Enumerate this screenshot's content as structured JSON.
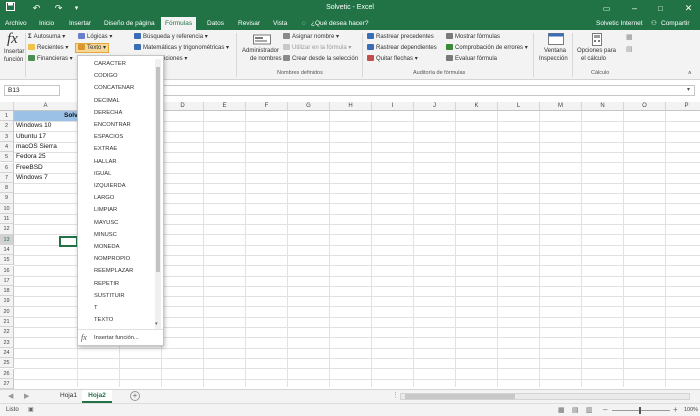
{
  "app": {
    "title": "Solvetic - Excel",
    "user": "Solvetic Internet",
    "share": "Compartir",
    "search_placeholder": "¿Qué desea hacer?"
  },
  "tabs": [
    "Archivo",
    "Inicio",
    "Insertar",
    "Diseño de página",
    "Fórmulas",
    "Datos",
    "Revisar",
    "Vista"
  ],
  "ribbon": {
    "insert_function": [
      "Insertar",
      "función"
    ],
    "autosuma": "Autosuma",
    "recientes": "Recientes",
    "financieras": "Financieras",
    "logicas": "Lógicas",
    "texto": "Texto",
    "busqueda": "Búsqueda y referencia",
    "matematicas": "Matemáticas y trigonométricas",
    "funciones_partial": "iciones",
    "admin_nombres": [
      "Administrador",
      "de nombres"
    ],
    "asignar_nombre": "Asignar nombre",
    "utilizar_formula": "Utilizar en la fórmula",
    "crear_seleccion": "Crear desde la selección",
    "nombres_definidos": "Nombres definidos",
    "rastrear_precedentes": "Rastrear precedentes",
    "rastrear_dependientes": "Rastrear dependientes",
    "quitar_flechas": "Quitar flechas",
    "mostrar_formulas": "Mostrar fórmulas",
    "comprobacion_errores": "Comprobación de errores",
    "evaluar_formula": "Evaluar fórmula",
    "auditoria": "Auditoría de fórmulas",
    "ventana_inspeccion": [
      "Ventana",
      "Inspección"
    ],
    "opciones_calculo": [
      "Opciones para",
      "el cálculo"
    ],
    "calculo": "Cálculo"
  },
  "namebox": "B13",
  "columns": [
    "A",
    "B",
    "C",
    "D",
    "E",
    "F",
    "G",
    "H",
    "I",
    "J",
    "K",
    "L",
    "M",
    "N",
    "O",
    "P"
  ],
  "rows": [
    "1",
    "2",
    "3",
    "4",
    "5",
    "6",
    "7",
    "8",
    "9",
    "10",
    "11",
    "12",
    "13",
    "14",
    "15",
    "16",
    "17",
    "18",
    "19",
    "20",
    "21",
    "22",
    "23",
    "24",
    "25",
    "26",
    "27"
  ],
  "cells": {
    "header": "Solv",
    "a": [
      "Windows 10",
      "Ubuntu 17",
      "macOS Sierra",
      "Fedora 25",
      "FreeBSD",
      "Windows 7"
    ]
  },
  "dropdown": {
    "items": [
      "CARACTER",
      "CODIGO",
      "CONCATENAR",
      "DECIMAL",
      "DERECHA",
      "ENCONTRAR",
      "ESPACIOS",
      "EXTRAE",
      "HALLAR",
      "IGUAL",
      "IZQUIERDA",
      "LARGO",
      "LIMPIAR",
      "MAYUSC",
      "MINUSC",
      "MONEDA",
      "NOMPROPIO",
      "REEMPLAZAR",
      "REPETIR",
      "SUSTITUIR",
      "T",
      "TEXTO"
    ],
    "insert_function": "Insertar función..."
  },
  "sheets": [
    "Hoja1",
    "Hoja2"
  ],
  "status": {
    "left": "Listo",
    "zoom": "100%"
  },
  "colors": {
    "brand": "#217346",
    "header_fill": "#9bc2e6",
    "selection": "#217346"
  }
}
